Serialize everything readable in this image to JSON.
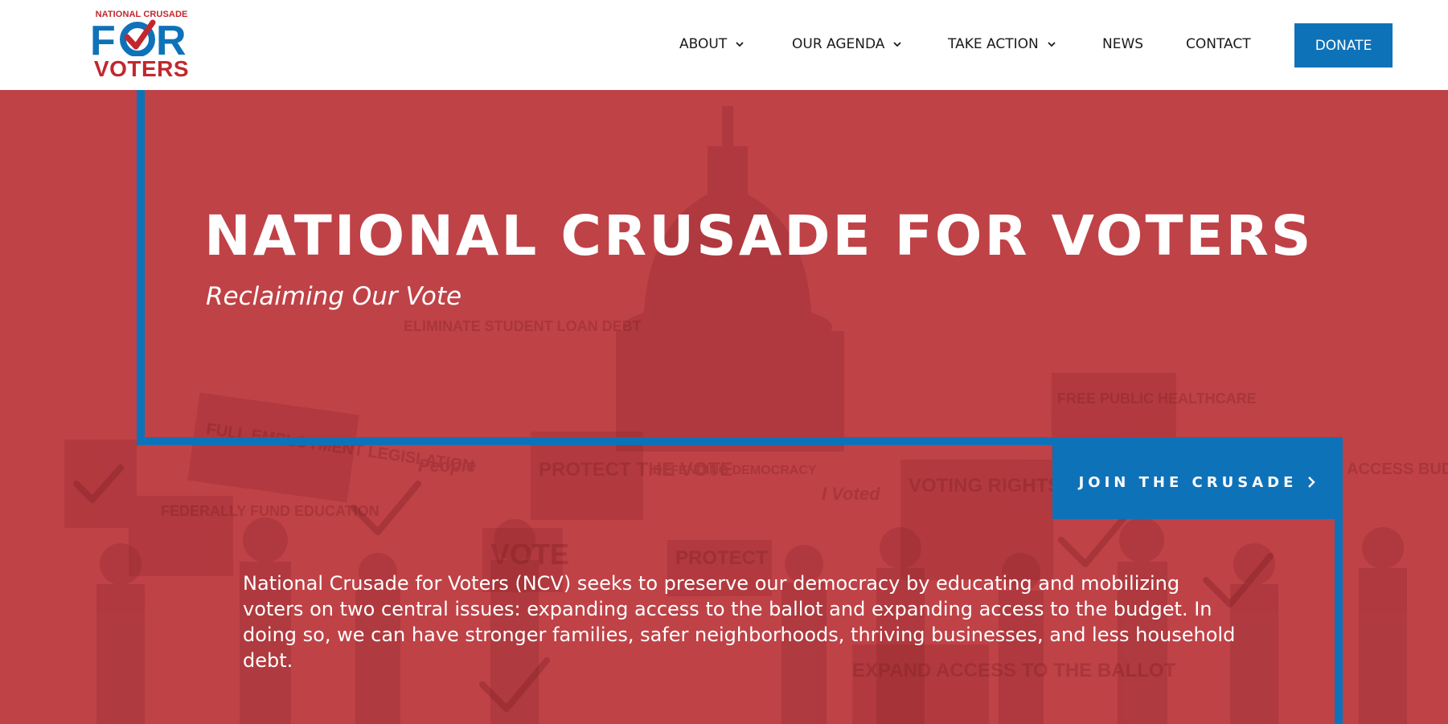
{
  "header": {
    "logo": {
      "top_line": "NATIONAL CRUSADE",
      "mid_line": "FOR",
      "bottom_line": "VOTERS",
      "colors": {
        "blue": "#0e72b9",
        "red": "#c1282d"
      }
    },
    "nav": [
      {
        "label": "ABOUT",
        "has_dropdown": true
      },
      {
        "label": "OUR AGENDA",
        "has_dropdown": true
      },
      {
        "label": "TAKE ACTION",
        "has_dropdown": true
      },
      {
        "label": "NEWS",
        "has_dropdown": false
      },
      {
        "label": "CONTACT",
        "has_dropdown": false
      }
    ],
    "donate_label": "DONATE"
  },
  "hero": {
    "title": "NATIONAL CRUSADE FOR VOTERS",
    "subtitle": "Reclaiming Our Vote",
    "cta_label": "JOIN THE CRUSADE",
    "body": "National Crusade for Voters (NCV) seeks to preserve our democracy by educating and mobilizing voters on two central issues: expanding access to the ballot and expanding access to the budget. In doing so, we can have stronger families, safer neighborhoods, thriving businesses, and less household debt.",
    "background_signs": [
      "ELIMINATE STUDENT LOAN DEBT",
      "FREE PUBLIC HEALTHCARE",
      "FULL EMPLOYMENT LEGISLATION",
      "FEDERALLY FUND EDUCATION",
      "PROTECT THE VOTE",
      "DEFENDING DEMOCRACY",
      "I Voted",
      "VOTING RIGHTS NOW!",
      "VOTE",
      "PROTECT",
      "EXPAND ACCESS TO THE BALLOT",
      "ACCESS BUDGET",
      "People"
    ],
    "colors": {
      "overlay": "#bf4247",
      "frame": "#0e72b9"
    }
  }
}
